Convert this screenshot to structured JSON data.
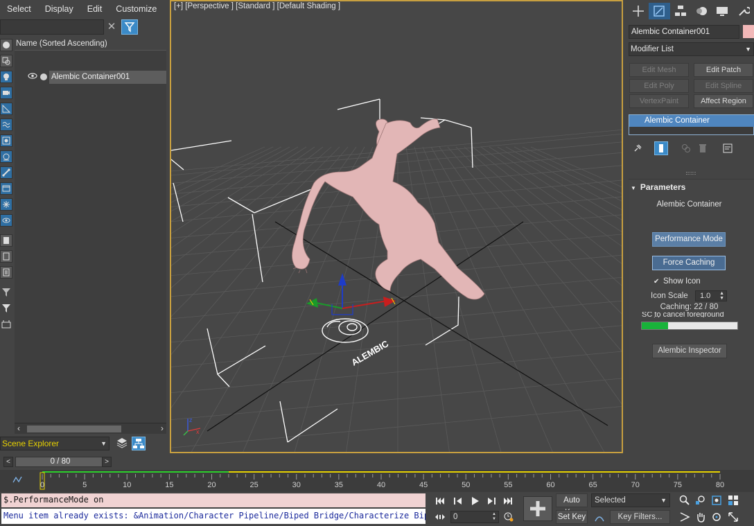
{
  "menu": [
    "Select",
    "Display",
    "Edit",
    "Customize"
  ],
  "explorer": {
    "column_header": "Name (Sorted Ascending)",
    "item": "Alembic Container001",
    "panel_name": "Scene Explorer"
  },
  "viewport": {
    "label": "[+] [Perspective ] [Standard ] [Default Shading ]",
    "alembic_logo_text": "ALEMBIC"
  },
  "command_panel": {
    "object_name": "Alembic Container001",
    "object_color": "#f2b8b8",
    "modifier_list": "Modifier List",
    "modifier_buttons": [
      "Edit Mesh",
      "Edit Patch",
      "Edit Poly",
      "Edit Spline",
      "VertexPaint",
      "Affect Region"
    ],
    "stack_item": "Alembic Container",
    "params": {
      "header": "Parameters",
      "subtitle": "Alembic Container",
      "performance_mode": "Performance Mode",
      "force_caching": "Force Caching",
      "show_icon": "Show Icon",
      "icon_scale_label": "Icon Scale",
      "icon_scale_value": "1.0",
      "caching": "Caching: 22 / 80",
      "esc_text": "SC to cancel foreground cachin",
      "progress": 0.275,
      "inspector": "Alembic Inspector"
    }
  },
  "timeline": {
    "frame_display": "0 / 80",
    "ticks": [
      "0",
      "5",
      "10",
      "15",
      "20",
      "25",
      "30",
      "35",
      "40",
      "45",
      "50",
      "55",
      "60",
      "65",
      "70",
      "75",
      "80"
    ],
    "cached_until": 22,
    "total": 80
  },
  "listener": {
    "input": "$.PerformanceMode on",
    "output": "Menu item already exists: &Animation/Character Pipeline/Biped Bridge/Characterize Biped"
  },
  "anim_controls": {
    "auto_key": "Auto Key",
    "set_key": "Set Key",
    "selected": "Selected",
    "key_filters": "Key Filters...",
    "time_value": "0"
  }
}
